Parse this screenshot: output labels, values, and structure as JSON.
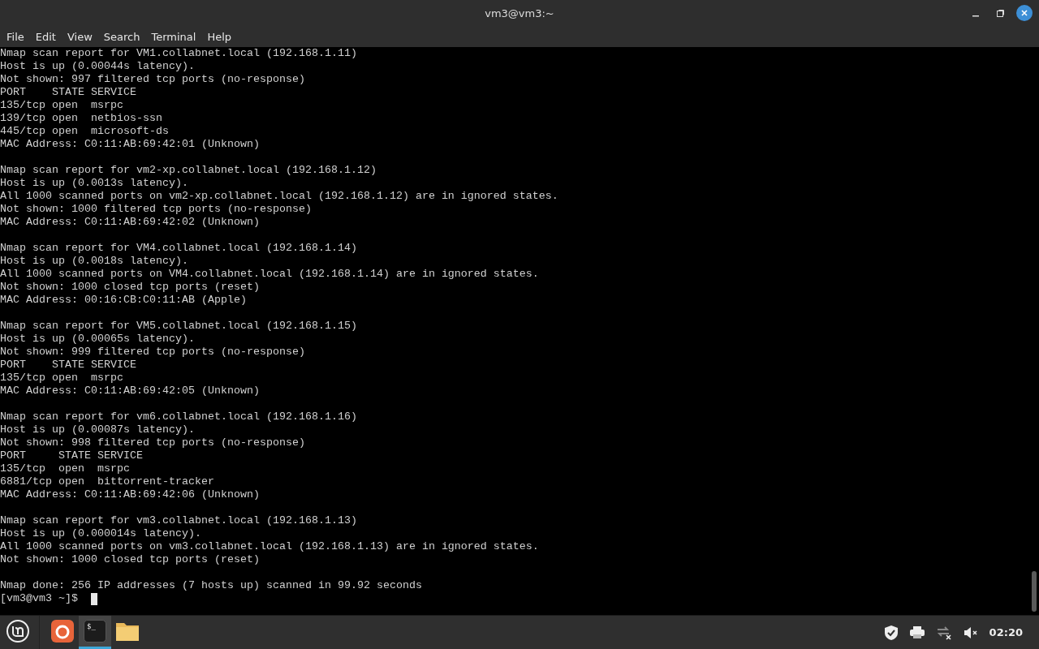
{
  "window": {
    "title": "vm3@vm3:~"
  },
  "menu": [
    "File",
    "Edit",
    "View",
    "Search",
    "Terminal",
    "Help"
  ],
  "terminal": {
    "blocks": [
      {
        "lines": [
          "Nmap scan report for VM1.collabnet.local (192.168.1.11)",
          "Host is up (0.00044s latency).",
          "Not shown: 997 filtered tcp ports (no-response)",
          "PORT    STATE SERVICE",
          "135/tcp open  msrpc",
          "139/tcp open  netbios-ssn",
          "445/tcp open  microsoft-ds",
          "MAC Address: C0:11:AB:69:42:01 (Unknown)"
        ]
      },
      {
        "lines": [
          "Nmap scan report for vm2-xp.collabnet.local (192.168.1.12)",
          "Host is up (0.0013s latency).",
          "All 1000 scanned ports on vm2-xp.collabnet.local (192.168.1.12) are in ignored states.",
          "Not shown: 1000 filtered tcp ports (no-response)",
          "MAC Address: C0:11:AB:69:42:02 (Unknown)"
        ]
      },
      {
        "lines": [
          "Nmap scan report for VM4.collabnet.local (192.168.1.14)",
          "Host is up (0.0018s latency).",
          "All 1000 scanned ports on VM4.collabnet.local (192.168.1.14) are in ignored states.",
          "Not shown: 1000 closed tcp ports (reset)",
          "MAC Address: 00:16:CB:C0:11:AB (Apple)"
        ]
      },
      {
        "lines": [
          "Nmap scan report for VM5.collabnet.local (192.168.1.15)",
          "Host is up (0.00065s latency).",
          "Not shown: 999 filtered tcp ports (no-response)",
          "PORT    STATE SERVICE",
          "135/tcp open  msrpc",
          "MAC Address: C0:11:AB:69:42:05 (Unknown)"
        ]
      },
      {
        "lines": [
          "Nmap scan report for vm6.collabnet.local (192.168.1.16)",
          "Host is up (0.00087s latency).",
          "Not shown: 998 filtered tcp ports (no-response)",
          "PORT     STATE SERVICE",
          "135/tcp  open  msrpc",
          "6881/tcp open  bittorrent-tracker",
          "MAC Address: C0:11:AB:69:42:06 (Unknown)"
        ]
      },
      {
        "lines": [
          "Nmap scan report for vm3.collabnet.local (192.168.1.13)",
          "Host is up (0.000014s latency).",
          "All 1000 scanned ports on vm3.collabnet.local (192.168.1.13) are in ignored states.",
          "Not shown: 1000 closed tcp ports (reset)"
        ]
      },
      {
        "lines": [
          "Nmap done: 256 IP addresses (7 hosts up) scanned in 99.92 seconds"
        ]
      }
    ],
    "prompt": "[vm3@vm3 ~]$"
  },
  "taskbar": {
    "apps": [
      {
        "kind": "firefox",
        "active": false
      },
      {
        "kind": "terminal",
        "active": true,
        "glyph": "$_"
      },
      {
        "kind": "files",
        "active": false
      }
    ],
    "clock": "02:20"
  }
}
